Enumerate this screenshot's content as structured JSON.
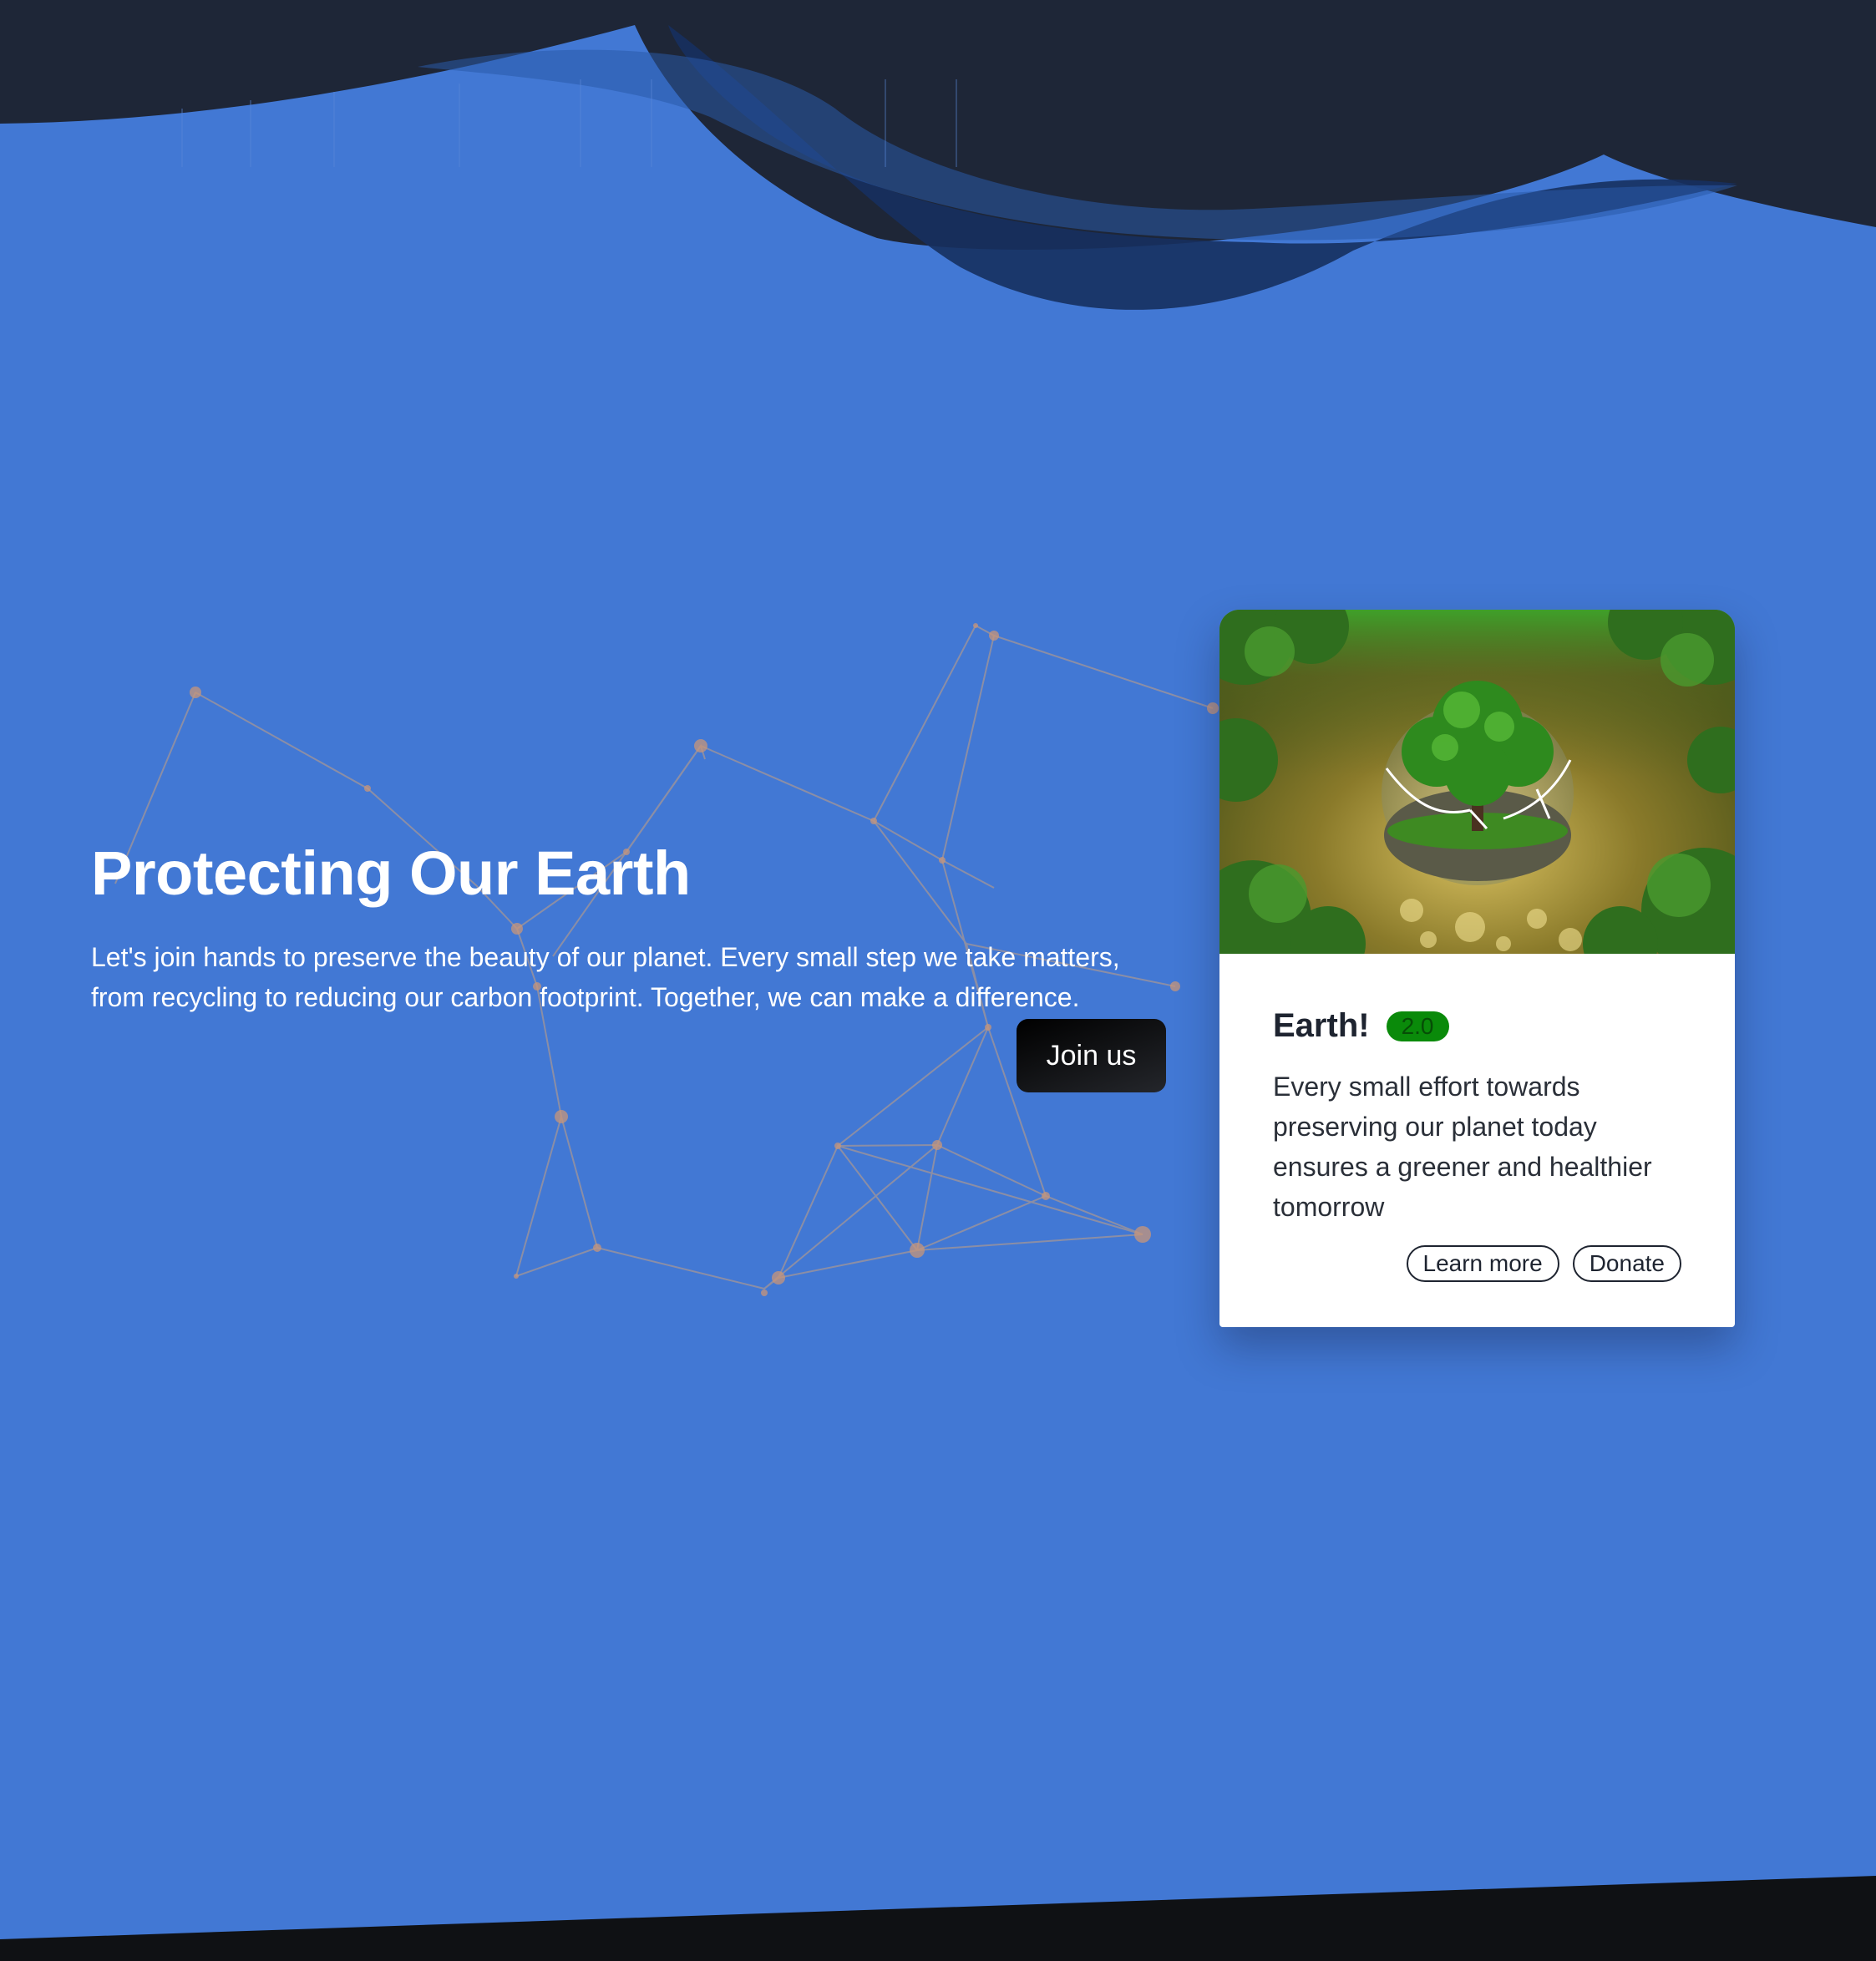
{
  "hero": {
    "title": "Protecting Our Earth",
    "description": "Let's join hands to preserve the beauty of our planet. Every small step we take matters, from recycling to reducing our carbon footprint. Together, we can make a difference.",
    "cta_label": "Join us"
  },
  "card": {
    "title": "Earth!",
    "badge": "2.0",
    "text": "Every small effort towards preserving our planet today ensures a greener and healthier tomorrow",
    "actions": {
      "learn_more": "Learn more",
      "donate": "Donate"
    }
  },
  "colors": {
    "background": "#4278d4",
    "wave_dark": "#1e2637",
    "wave_navy": "#16305f",
    "footer": "#0f1114",
    "particle": "#c8a080",
    "badge": "#0a8a0a"
  },
  "icons": {
    "card_image": "tree-in-globe-image"
  }
}
